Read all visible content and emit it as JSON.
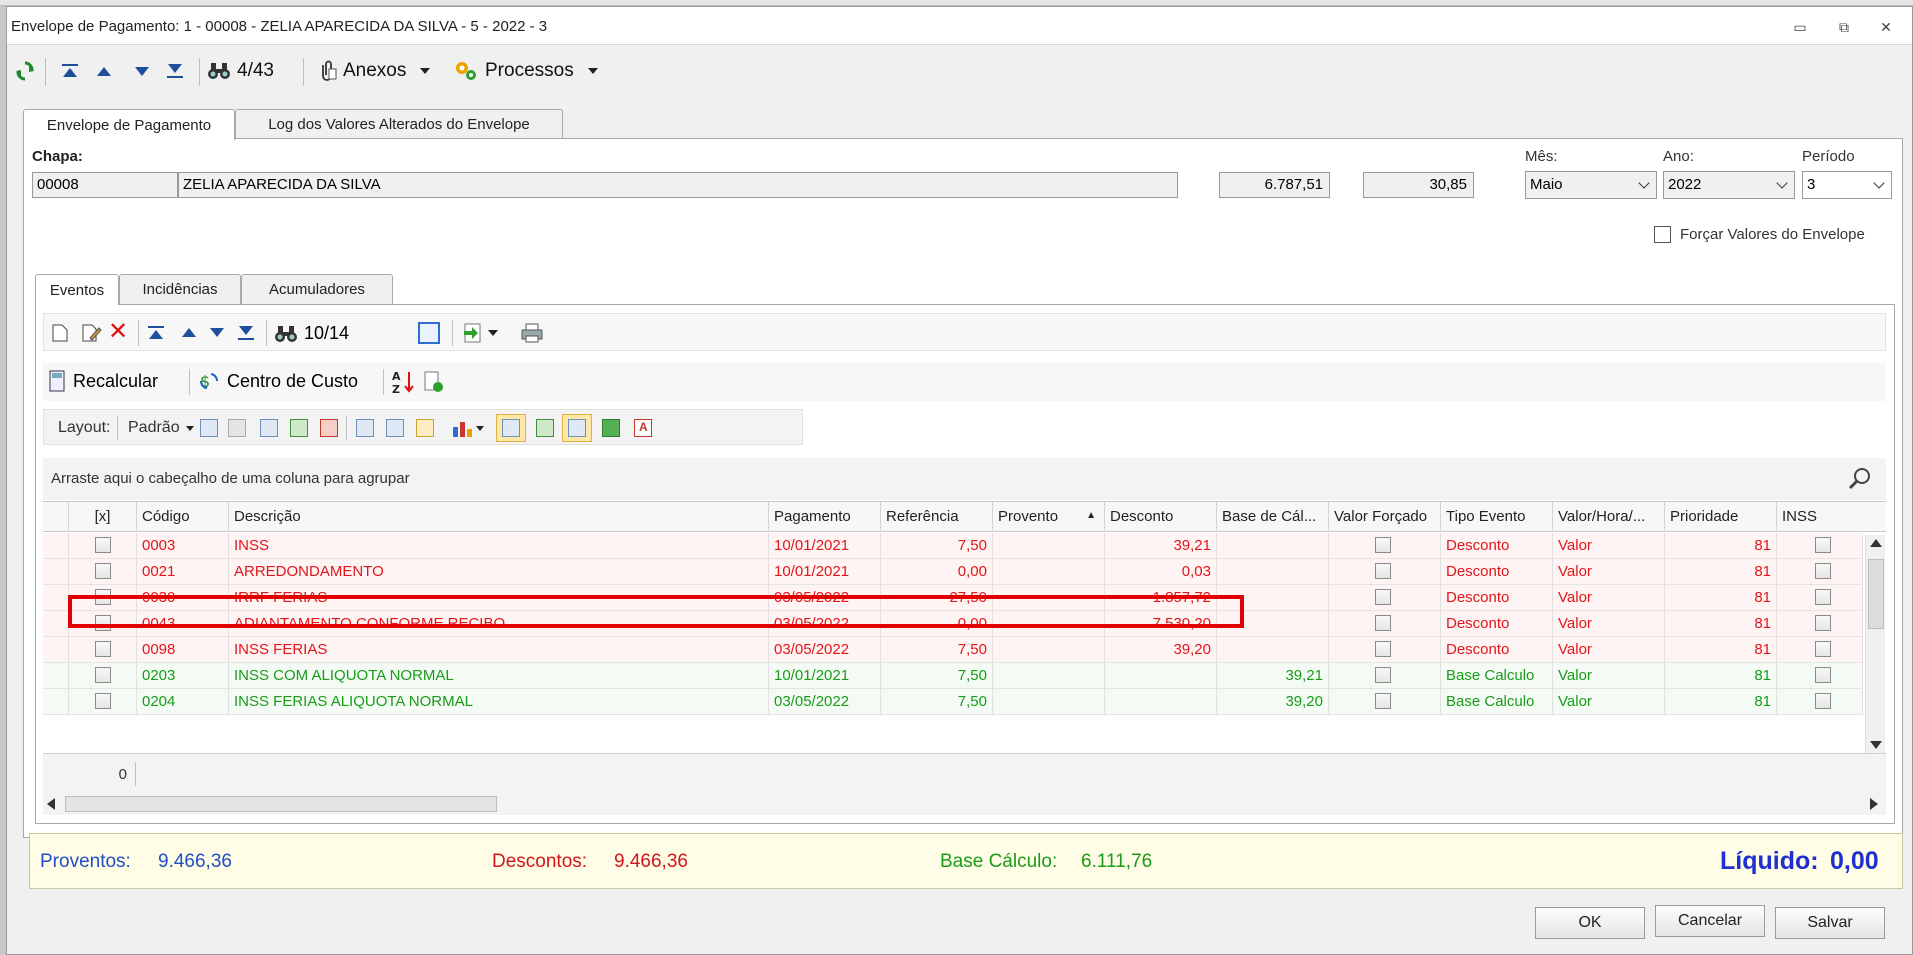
{
  "window": {
    "title": "Envelope de Pagamento: 1 - 00008 - ZELIA APARECIDA DA SILVA - 5 - 2022 - 3",
    "minimize_glyph": "▭",
    "restore_glyph": "⧉",
    "close_glyph": "✕"
  },
  "toolbar": {
    "record_counter": "4/43",
    "anexos_label": "Anexos",
    "processos_label": "Processos"
  },
  "tabs": [
    {
      "label": "Envelope de Pagamento",
      "active": true
    },
    {
      "label": "Log dos Valores Alterados do Envelope",
      "active": false
    }
  ],
  "header": {
    "chapa_label": "Chapa:",
    "chapa_value": "00008",
    "nome_value": "ZELIA APARECIDA DA SILVA",
    "valor1": "6.787,51",
    "valor2": "30,85",
    "mes_label": "Mês:",
    "mes_value": "Maio",
    "ano_label": "Ano:",
    "ano_value": "2022",
    "periodo_label": "Período",
    "periodo_value": "3",
    "forcar_label": "Forçar Valores do Envelope"
  },
  "subtabs": [
    {
      "label": "Eventos",
      "active": true
    },
    {
      "label": "Incidências",
      "active": false
    },
    {
      "label": "Acumuladores",
      "active": false
    }
  ],
  "events_toolbar": {
    "record_counter": "10/14",
    "recalcular_label": "Recalcular",
    "centro_custo_label": "Centro de Custo"
  },
  "layoutbar": {
    "layout_label": "Layout:",
    "padrao_label": "Padrão"
  },
  "grid": {
    "group_hint": "Arraste aqui o cabeçalho de uma coluna para agrupar",
    "columns": [
      "[x]",
      "Código",
      "Descrição",
      "Pagamento",
      "Referência",
      "Provento",
      "Desconto",
      "Base de Cál...",
      "Valor Forçado",
      "Tipo Evento",
      "Valor/Hora/...",
      "Prioridade",
      "INSS"
    ],
    "sort_indicator": "▲",
    "rows": [
      {
        "codigo": "0003",
        "descricao": "INSS",
        "pagamento": "10/01/2021",
        "referencia": "7,50",
        "provento": "",
        "desconto": "39,21",
        "base": "",
        "tipo": "Desconto",
        "valor_hora": "Valor",
        "prioridade": "81",
        "color": "red"
      },
      {
        "codigo": "0021",
        "descricao": "ARREDONDAMENTO",
        "pagamento": "10/01/2021",
        "referencia": "0,00",
        "provento": "",
        "desconto": "0,03",
        "base": "",
        "tipo": "Desconto",
        "valor_hora": "Valor",
        "prioridade": "81",
        "color": "red"
      },
      {
        "codigo": "0030",
        "descricao": "IRRF FERIAS",
        "pagamento": "03/05/2022",
        "referencia": "27,50",
        "provento": "",
        "desconto": "1.857,72",
        "base": "",
        "tipo": "Desconto",
        "valor_hora": "Valor",
        "prioridade": "81",
        "color": "red"
      },
      {
        "codigo": "0043",
        "descricao": "ADIANTAMENTO CONFORME RECIBO",
        "pagamento": "03/05/2022",
        "referencia": "0,00",
        "provento": "",
        "desconto": "7.530,20",
        "base": "",
        "tipo": "Desconto",
        "valor_hora": "Valor",
        "prioridade": "81",
        "color": "red"
      },
      {
        "codigo": "0098",
        "descricao": "INSS FERIAS",
        "pagamento": "03/05/2022",
        "referencia": "7,50",
        "provento": "",
        "desconto": "39,20",
        "base": "",
        "tipo": "Desconto",
        "valor_hora": "Valor",
        "prioridade": "81",
        "color": "red"
      },
      {
        "codigo": "0203",
        "descricao": "INSS COM ALIQUOTA NORMAL",
        "pagamento": "10/01/2021",
        "referencia": "7,50",
        "provento": "",
        "desconto": "",
        "base": "39,21",
        "tipo": "Base Calculo",
        "valor_hora": "Valor",
        "prioridade": "81",
        "color": "green"
      },
      {
        "codigo": "0204",
        "descricao": "INSS FERIAS ALIQUOTA NORMAL",
        "pagamento": "03/05/2022",
        "referencia": "7,50",
        "provento": "",
        "desconto": "",
        "base": "39,20",
        "tipo": "Base Calculo",
        "valor_hora": "Valor",
        "prioridade": "81",
        "color": "green"
      }
    ],
    "footer_count": "0"
  },
  "totals": {
    "proventos_label": "Proventos:",
    "proventos_value": "9.466,36",
    "descontos_label": "Descontos:",
    "descontos_value": "9.466,36",
    "base_label": "Base Cálculo:",
    "base_value": "6.111,76",
    "liquido_label": "Líquido:",
    "liquido_value": "0,00"
  },
  "buttons": {
    "ok": "OK",
    "cancelar": "Cancelar",
    "salvar": "Salvar"
  },
  "colors": {
    "desconto_text": "#e0161b",
    "base_text": "#1a9b1a",
    "proventos_text": "#1f4fc8",
    "liquido_text": "#1f2fd0",
    "highlight_border": "#e30000"
  }
}
